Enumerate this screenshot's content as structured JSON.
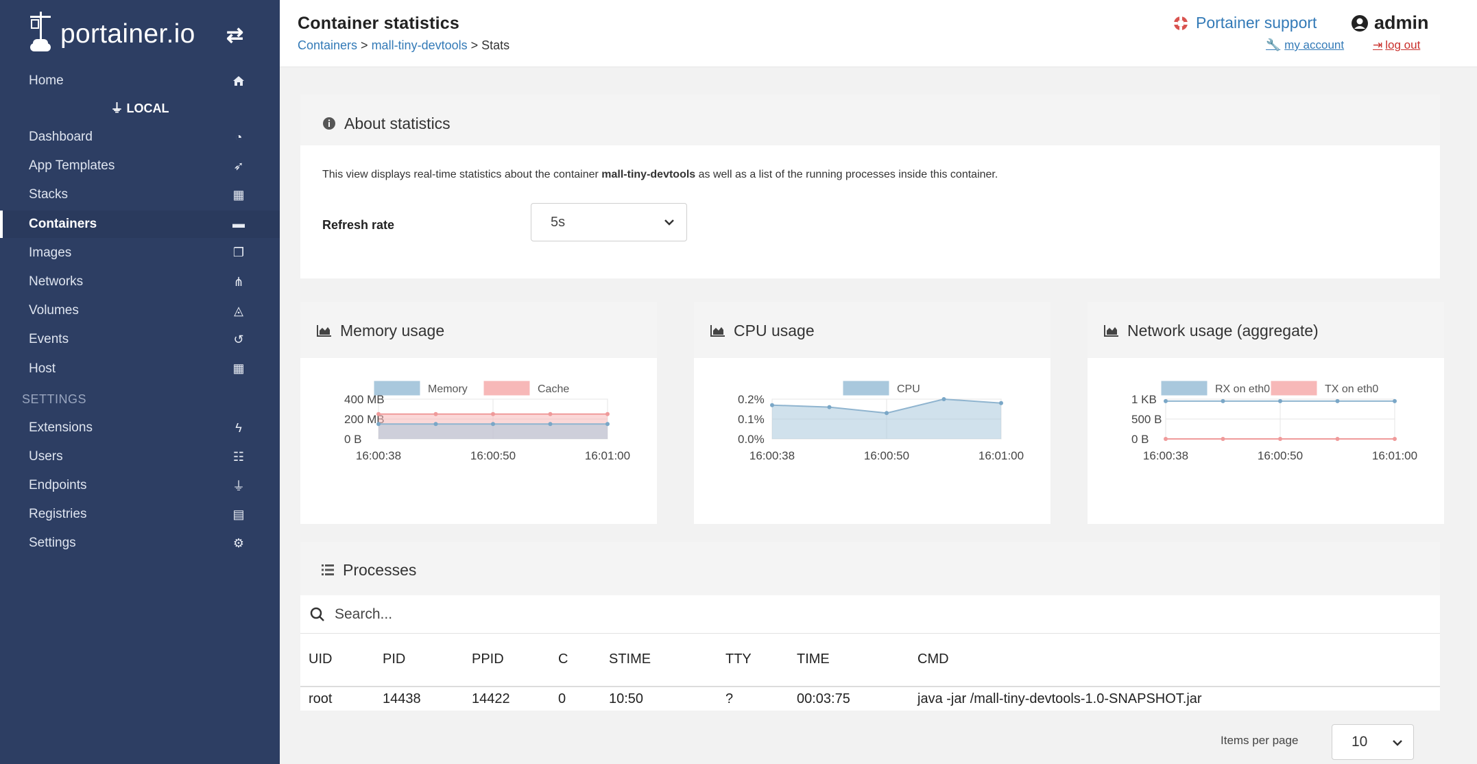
{
  "brand": {
    "name": "portainer.io",
    "toggle_icon": "arrows-swap-icon"
  },
  "sidebar": {
    "home": {
      "label": "Home",
      "icon": "home-icon"
    },
    "endpoint": "LOCAL",
    "items": [
      {
        "label": "Dashboard",
        "icon": "dashboard-icon"
      },
      {
        "label": "App Templates",
        "icon": "rocket-icon"
      },
      {
        "label": "Stacks",
        "icon": "stacks-icon"
      },
      {
        "label": "Containers",
        "icon": "server-icon",
        "active": true
      },
      {
        "label": "Images",
        "icon": "clone-icon"
      },
      {
        "label": "Networks",
        "icon": "sitemap-icon"
      },
      {
        "label": "Volumes",
        "icon": "cubes-icon"
      },
      {
        "label": "Events",
        "icon": "history-icon"
      },
      {
        "label": "Host",
        "icon": "th-icon"
      }
    ],
    "settings_header": "SETTINGS",
    "settings_items": [
      {
        "label": "Extensions",
        "icon": "bolt-icon"
      },
      {
        "label": "Users",
        "icon": "users-icon"
      },
      {
        "label": "Endpoints",
        "icon": "plug-icon"
      },
      {
        "label": "Registries",
        "icon": "database-icon"
      },
      {
        "label": "Settings",
        "icon": "cogs-icon"
      }
    ]
  },
  "header": {
    "title": "Container statistics",
    "breadcrumb": {
      "containers": "Containers",
      "sep1": " > ",
      "container": "mall-tiny-devtools",
      "sep2": " > ",
      "current": "Stats"
    },
    "support": "Portainer support",
    "user": "admin",
    "my_account": "my account",
    "log_out": "log out"
  },
  "about": {
    "title": "About statistics",
    "text_prefix": "This view displays real-time statistics about the container ",
    "container": "mall-tiny-devtools",
    "text_suffix": " as well as a list of the running processes inside this container.",
    "refresh_label": "Refresh rate",
    "refresh_value": "5s"
  },
  "charts": {
    "memory_title": "Memory usage",
    "cpu_title": "CPU usage",
    "network_title": "Network usage (aggregate)"
  },
  "chart_data": [
    {
      "type": "area",
      "title": "Memory usage",
      "x": [
        "16:00:38",
        "16:00:44",
        "16:00:50",
        "16:00:55",
        "16:01:00"
      ],
      "x_ticks": [
        "16:00:38",
        "16:00:50",
        "16:01:00"
      ],
      "y_ticks": [
        "400 MB",
        "200 MB",
        "0 B"
      ],
      "ylim": [
        0,
        400
      ],
      "series": [
        {
          "name": "Memory",
          "color": "#a9c8dd",
          "values": [
            150,
            150,
            150,
            150,
            150
          ]
        },
        {
          "name": "Cache",
          "color": "#f7b8b8",
          "values": [
            250,
            250,
            250,
            250,
            250
          ]
        }
      ]
    },
    {
      "type": "area",
      "title": "CPU usage",
      "x": [
        "16:00:38",
        "16:00:44",
        "16:00:50",
        "16:00:55",
        "16:01:00"
      ],
      "x_ticks": [
        "16:00:38",
        "16:00:50",
        "16:01:00"
      ],
      "y_ticks": [
        "0.2%",
        "0.1%",
        "0.0%"
      ],
      "ylim": [
        0,
        0.2
      ],
      "series": [
        {
          "name": "CPU",
          "color": "#a9c8dd",
          "values": [
            0.17,
            0.16,
            0.13,
            0.2,
            0.18
          ]
        }
      ]
    },
    {
      "type": "line",
      "title": "Network usage (aggregate)",
      "x": [
        "16:00:38",
        "16:00:44",
        "16:00:50",
        "16:00:55",
        "16:01:00"
      ],
      "x_ticks": [
        "16:00:38",
        "16:00:50",
        "16:01:00"
      ],
      "y_ticks": [
        "1 KB",
        "500 B",
        "0 B"
      ],
      "ylim": [
        0,
        1000
      ],
      "series": [
        {
          "name": "RX on eth0",
          "color": "#a9c8dd",
          "values": [
            950,
            950,
            950,
            950,
            950
          ]
        },
        {
          "name": "TX on eth0",
          "color": "#f7b8b8",
          "values": [
            0,
            0,
            0,
            0,
            0
          ]
        }
      ]
    }
  ],
  "processes": {
    "title": "Processes",
    "search_placeholder": "Search...",
    "columns": [
      "UID",
      "PID",
      "PPID",
      "C",
      "STIME",
      "TTY",
      "TIME",
      "CMD"
    ],
    "rows": [
      [
        "root",
        "14438",
        "14422",
        "0",
        "10:50",
        "?",
        "00:03:75",
        "java -jar /mall-tiny-devtools-1.0-SNAPSHOT.jar"
      ]
    ],
    "items_per_page_label": "Items per page",
    "items_per_page": "10"
  },
  "colors": {
    "sidebar": "#2d3e63",
    "link": "#337ab7",
    "logout": "#c9302c",
    "support": "#d9534f"
  }
}
